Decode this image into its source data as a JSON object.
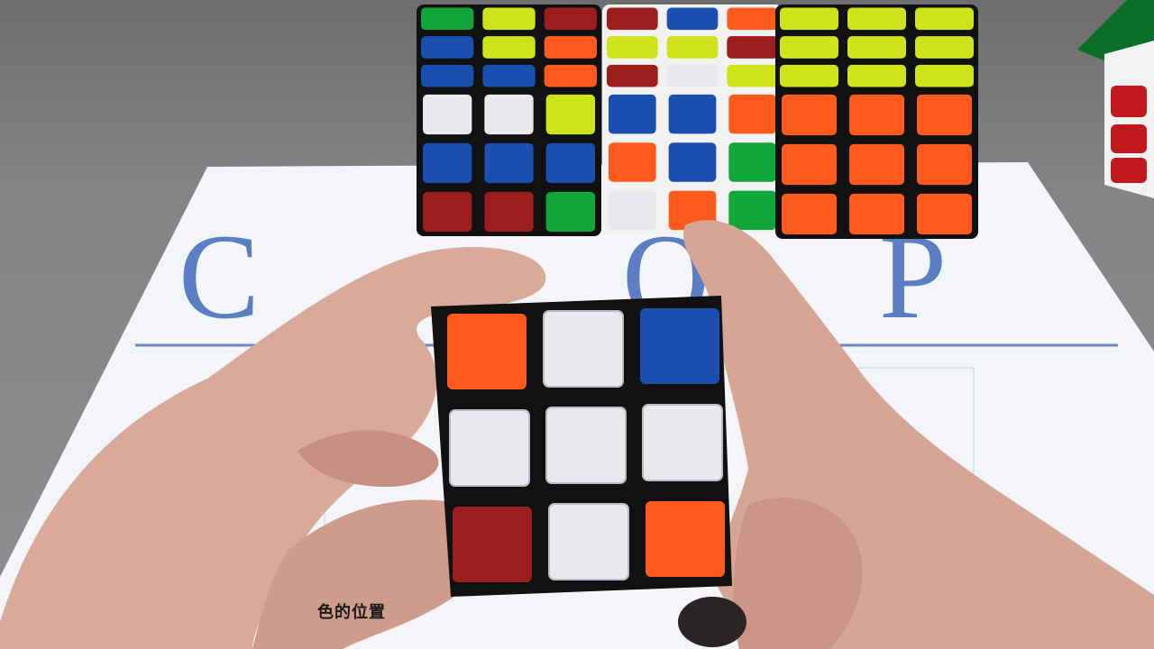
{
  "sheet": {
    "letters": [
      "C",
      "O",
      "P"
    ],
    "bottom_text_visible": "色的位置"
  },
  "colors": {
    "orange": "#ff5a1e",
    "white": "#e8e9ec",
    "blue": "#1a4fb0",
    "red": "#9b1d1d",
    "green": "#12a53a",
    "yellow": "#cfe31a",
    "cube_body_black": "#111111",
    "cube_body_white": "#f2f2f2",
    "sheet": "#f3f5f8",
    "letter_blue": "#5b7fc2"
  },
  "held_cube_face": [
    [
      "orange",
      "white",
      "blue"
    ],
    [
      "white",
      "white",
      "white"
    ],
    [
      "red",
      "white",
      "orange"
    ]
  ],
  "background_cubes": [
    {
      "name": "left-cube",
      "body": "black",
      "top": [
        [
          "green",
          "yellow",
          "red"
        ],
        [
          "blue",
          "yellow",
          "orange"
        ],
        [
          "blue",
          "blue",
          "orange"
        ]
      ],
      "front": [
        [
          "white",
          "white",
          "yellow"
        ],
        [
          "blue",
          "blue",
          "blue"
        ],
        [
          "red",
          "red",
          "green"
        ]
      ]
    },
    {
      "name": "middle-cube",
      "body": "white",
      "top": [
        [
          "red",
          "blue",
          "orange"
        ],
        [
          "yellow",
          "yellow",
          "red"
        ],
        [
          "red",
          "white",
          "yellow"
        ]
      ],
      "front": [
        [
          "blue",
          "blue",
          "orange"
        ],
        [
          "orange",
          "blue",
          "green"
        ],
        [
          "white",
          "orange",
          "green"
        ]
      ]
    },
    {
      "name": "right-cube",
      "body": "black",
      "top": [
        [
          "yellow",
          "yellow",
          "yellow"
        ],
        [
          "yellow",
          "yellow",
          "yellow"
        ],
        [
          "yellow",
          "yellow",
          "yellow"
        ]
      ],
      "front": [
        [
          "orange",
          "orange",
          "orange"
        ],
        [
          "orange",
          "orange",
          "orange"
        ],
        [
          "orange",
          "orange",
          "orange"
        ]
      ]
    }
  ]
}
